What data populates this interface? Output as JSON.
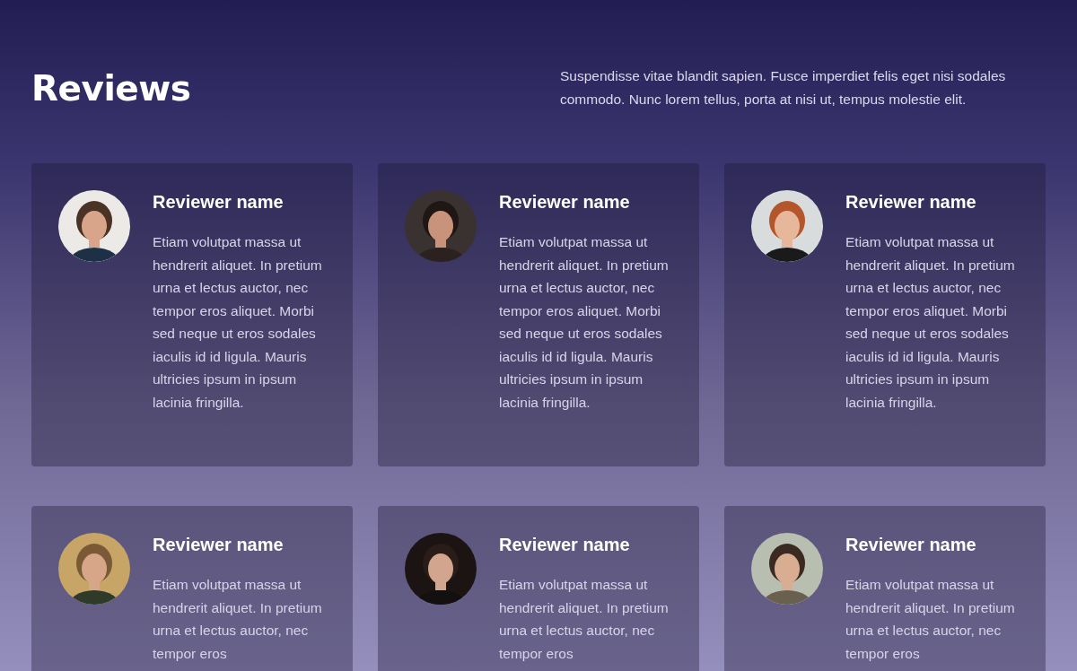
{
  "header": {
    "title": "Reviews",
    "intro": "Suspendisse vitae blandit sapien. Fusce imperdiet felis eget nisi sodales commodo. Nunc lorem tellus, porta at nisi ut, tempus molestie elit."
  },
  "reviews": [
    {
      "name": "Reviewer name",
      "text": "Etiam volutpat massa ut hendrerit aliquet. In pretium urna et lectus auctor, nec tempor eros aliquet. Morbi sed neque ut eros sodales iaculis id id ligula. Mauris ultricies ipsum in ipsum lacinia fringilla."
    },
    {
      "name": "Reviewer name",
      "text": "Etiam volutpat massa ut hendrerit aliquet. In pretium urna et lectus auctor, nec tempor eros aliquet. Morbi sed neque ut eros sodales iaculis id id ligula. Mauris ultricies ipsum in ipsum lacinia fringilla."
    },
    {
      "name": "Reviewer name",
      "text": "Etiam volutpat massa ut hendrerit aliquet. In pretium urna et lectus auctor, nec tempor eros aliquet. Morbi sed neque ut eros sodales iaculis id id ligula. Mauris ultricies ipsum in ipsum lacinia fringilla."
    },
    {
      "name": "Reviewer name",
      "text": "Etiam volutpat massa ut hendrerit aliquet. In pretium urna et lectus auctor, nec tempor eros"
    },
    {
      "name": "Reviewer name",
      "text": "Etiam volutpat massa ut hendrerit aliquet. In pretium urna et lectus auctor, nec tempor eros"
    },
    {
      "name": "Reviewer name",
      "text": "Etiam volutpat massa ut hendrerit aliquet. In pretium urna et lectus auctor, nec tempor eros"
    }
  ]
}
